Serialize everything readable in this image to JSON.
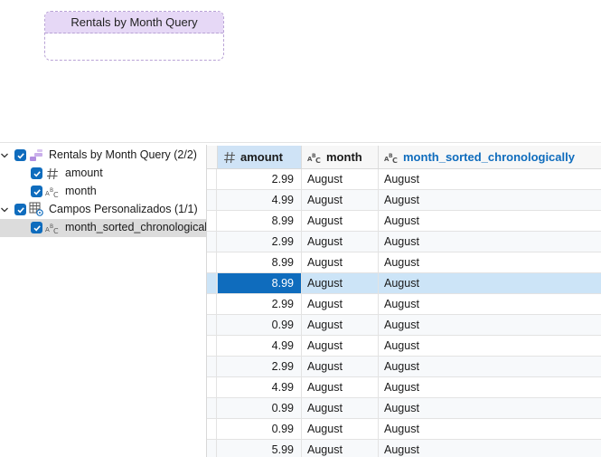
{
  "canvas": {
    "node_title": "Rentals by Month Query"
  },
  "tree": {
    "items": [
      {
        "label": "Rentals by Month Query (2/2)",
        "icon": "query-icon",
        "level": 0
      },
      {
        "label": "amount",
        "icon": "number-field-icon",
        "level": 1
      },
      {
        "label": "month",
        "icon": "text-field-icon",
        "level": 1
      },
      {
        "label": "Campos Personalizados (1/1)",
        "icon": "custom-fields-icon",
        "level": 0
      },
      {
        "label": "month_sorted_chronologically",
        "icon": "text-field-icon",
        "level": 1,
        "selected": true
      }
    ]
  },
  "grid": {
    "columns": [
      {
        "label": "amount",
        "icon": "number-field-icon"
      },
      {
        "label": "month",
        "icon": "text-field-icon"
      },
      {
        "label": "month_sorted_chronologically",
        "icon": "text-field-icon"
      }
    ],
    "rows": [
      [
        "2.99",
        "August",
        "August"
      ],
      [
        "4.99",
        "August",
        "August"
      ],
      [
        "8.99",
        "August",
        "August"
      ],
      [
        "2.99",
        "August",
        "August"
      ],
      [
        "8.99",
        "August",
        "August"
      ],
      [
        "8.99",
        "August",
        "August"
      ],
      [
        "2.99",
        "August",
        "August"
      ],
      [
        "0.99",
        "August",
        "August"
      ],
      [
        "4.99",
        "August",
        "August"
      ],
      [
        "2.99",
        "August",
        "August"
      ],
      [
        "4.99",
        "August",
        "August"
      ],
      [
        "0.99",
        "August",
        "August"
      ],
      [
        "0.99",
        "August",
        "August"
      ],
      [
        "5.99",
        "August",
        "August"
      ]
    ],
    "selected_row": 5
  },
  "colors": {
    "accent": "#0f6cbd",
    "selection": "#cce4f7",
    "node_header": "#e6d8f6"
  }
}
